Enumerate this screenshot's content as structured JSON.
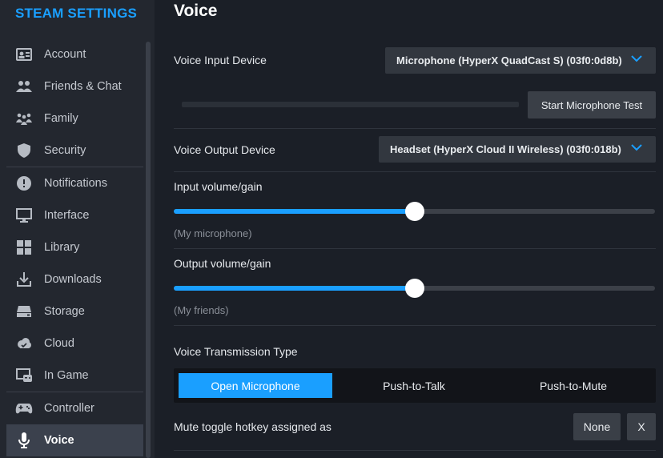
{
  "app": {
    "title": "STEAM SETTINGS"
  },
  "sidebar": {
    "items": [
      {
        "label": "Account",
        "icon": "account-icon"
      },
      {
        "label": "Friends & Chat",
        "icon": "friends-icon"
      },
      {
        "label": "Family",
        "icon": "family-icon"
      },
      {
        "label": "Security",
        "icon": "shield-icon"
      },
      {
        "label": "Notifications",
        "icon": "info-icon"
      },
      {
        "label": "Interface",
        "icon": "monitor-icon"
      },
      {
        "label": "Library",
        "icon": "grid-icon"
      },
      {
        "label": "Downloads",
        "icon": "download-icon"
      },
      {
        "label": "Storage",
        "icon": "drive-icon"
      },
      {
        "label": "Cloud",
        "icon": "cloud-icon"
      },
      {
        "label": "In Game",
        "icon": "in-game-icon"
      },
      {
        "label": "Controller",
        "icon": "gamepad-icon"
      },
      {
        "label": "Voice",
        "icon": "microphone-icon"
      }
    ],
    "active": "Voice"
  },
  "main": {
    "title": "Voice",
    "input_device": {
      "label": "Voice Input Device",
      "value": "Microphone (HyperX QuadCast S) (03f0:0d8b)",
      "test_button": "Start Microphone Test"
    },
    "output_device": {
      "label": "Voice Output Device",
      "value": "Headset (HyperX Cloud II Wireless) (03f0:018b)"
    },
    "input_volume": {
      "label": "Input volume/gain",
      "sublabel": "(My microphone)",
      "level_percent": 50
    },
    "output_volume": {
      "label": "Output volume/gain",
      "sublabel": "(My friends)",
      "level_percent": 50
    },
    "transmission": {
      "label": "Voice Transmission Type",
      "options": [
        "Open Microphone",
        "Push-to-Talk",
        "Push-to-Mute"
      ],
      "selected": "Open Microphone"
    },
    "hotkey": {
      "label": "Mute toggle hotkey assigned as",
      "value": "None",
      "clear": "X"
    }
  },
  "colors": {
    "accent": "#1a9fff",
    "sidebar_bg": "#23272f",
    "main_bg": "#1b1f27"
  }
}
